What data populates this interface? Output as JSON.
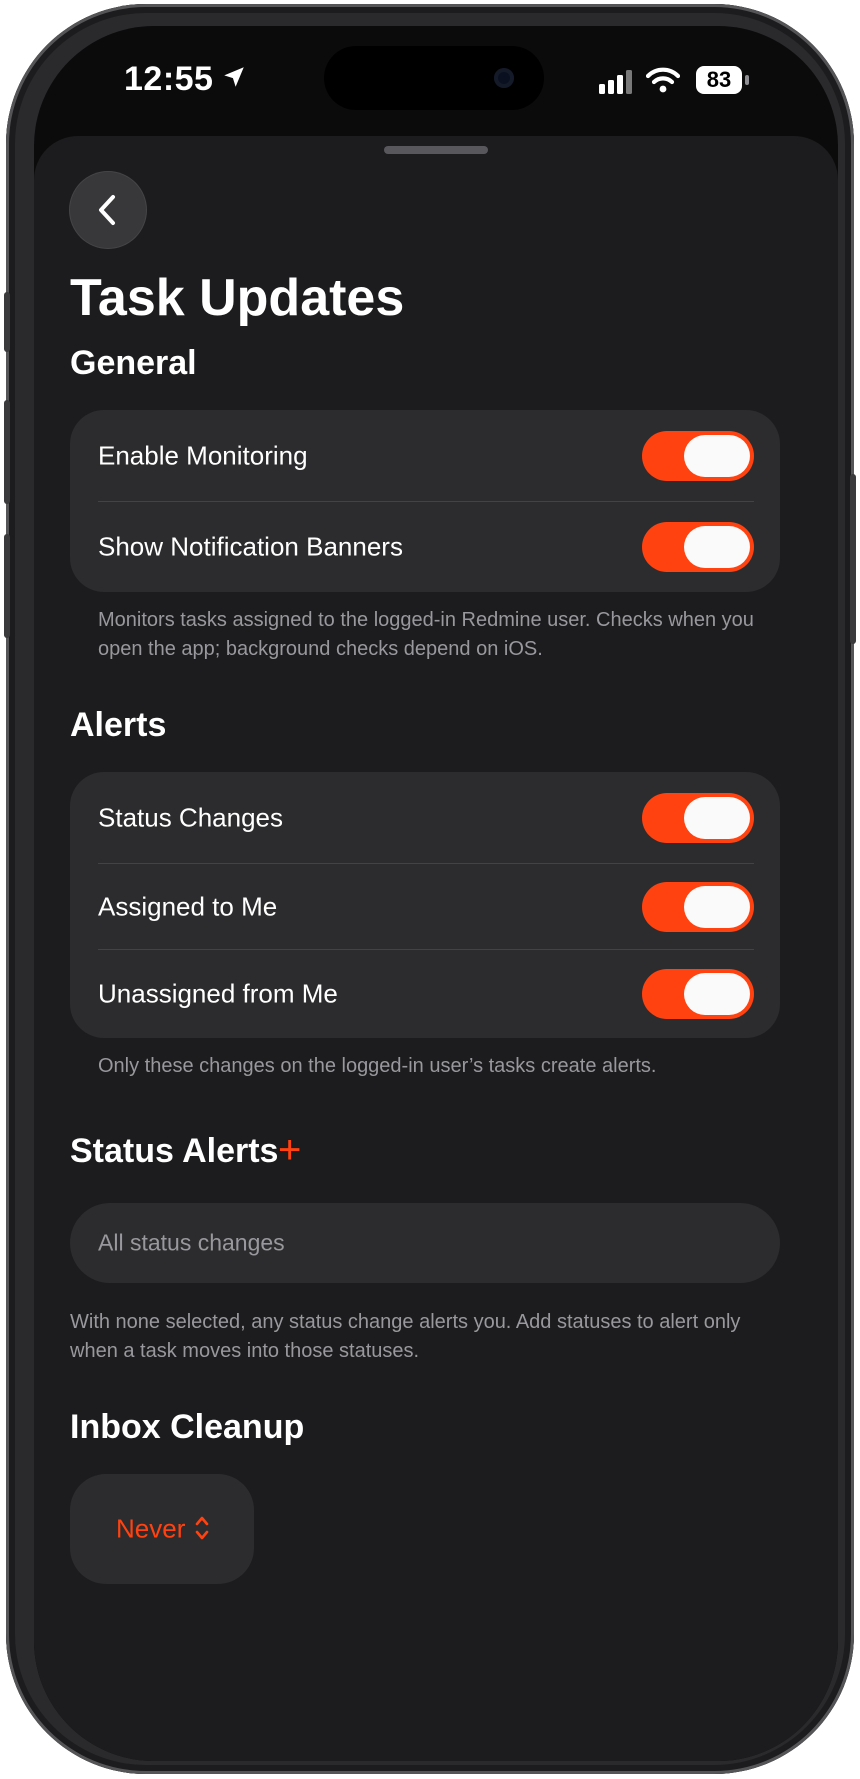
{
  "status_bar": {
    "time": "12:55",
    "battery": "83"
  },
  "header": {
    "title": "Task Updates"
  },
  "general": {
    "heading": "General",
    "rows": [
      {
        "label": "Enable Monitoring",
        "on": true
      },
      {
        "label": "Show Notification Banners",
        "on": true
      }
    ],
    "footer": "Monitors tasks assigned to the logged-in Redmine user. Checks when you open the app; background checks depend on iOS."
  },
  "alerts": {
    "heading": "Alerts",
    "rows": [
      {
        "label": "Status Changes",
        "on": true
      },
      {
        "label": "Assigned to Me",
        "on": true
      },
      {
        "label": "Unassigned from Me",
        "on": true
      }
    ],
    "footer": "Only these changes on the logged-in user’s tasks create alerts."
  },
  "status_alerts": {
    "heading": "Status Alerts",
    "add_symbol": "+",
    "placeholder": "All status changes",
    "footer": "With none selected, any status change alerts you. Add statuses to alert only when a task moves into those statuses."
  },
  "inbox_cleanup": {
    "heading": "Inbox Cleanup",
    "value": "Never"
  },
  "colors": {
    "accent": "#ff4210",
    "background": "#1c1c1e",
    "card": "#2c2c2e",
    "secondary_text": "#98989d"
  },
  "icons": [
    "location-arrow-icon",
    "cellular-signal-icon",
    "wifi-icon",
    "battery-icon",
    "chevron-left-icon",
    "plus-icon",
    "chevron-up-down-icon"
  ]
}
